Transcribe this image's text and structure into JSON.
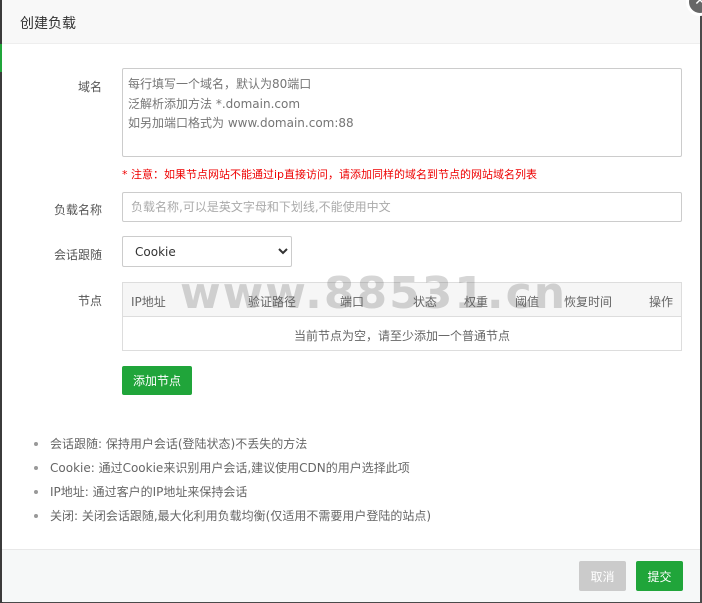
{
  "dialog": {
    "title": "创建负载",
    "close_icon": "close-icon"
  },
  "form": {
    "domain_label": "域名",
    "domain_placeholder": "每行填写一个域名，默认为80端口\n泛解析添加方法 *.domain.com\n如另加端口格式为 www.domain.com:88",
    "domain_notice": "* 注意：如果节点网站不能通过ip直接访问，请添加同样的域名到节点的网站域名列表",
    "name_label": "负载名称",
    "name_placeholder": "负载名称,可以是英文字母和下划线,不能使用中文",
    "session_label": "会话跟随",
    "session_value": "Cookie",
    "session_options": [
      "Cookie"
    ],
    "nodes_label": "节点"
  },
  "nodes_table": {
    "columns": [
      "IP地址",
      "验证路径",
      "端口",
      "状态",
      "权重",
      "阈值",
      "恢复时间",
      "操作"
    ],
    "empty_text": "当前节点为空，请至少添加一个普通节点"
  },
  "add_node_button": "添加节点",
  "tips": [
    "会话跟随: 保持用户会话(登陆状态)不丢失的方法",
    "Cookie: 通过Cookie来识别用户会话,建议使用CDN的用户选择此项",
    "IP地址: 通过客户的IP地址来保持会话",
    "关闭: 关闭会话跟随,最大化利用负载均衡(仅适用不需要用户登陆的站点)"
  ],
  "footer": {
    "cancel_label": "取消",
    "submit_label": "提交"
  },
  "watermark": "www.88531.cn",
  "colors": {
    "accent": "#20a53a",
    "danger": "#e00000",
    "cancel": "#cbcbcb"
  }
}
